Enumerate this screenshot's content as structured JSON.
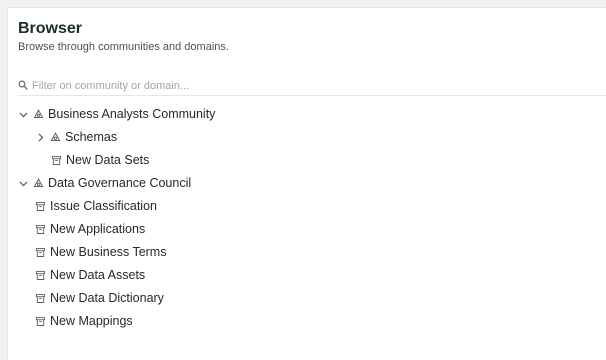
{
  "header": {
    "title": "Browser",
    "subtitle": "Browse through communities and domains."
  },
  "filter": {
    "placeholder": "Filter on community or domain..."
  },
  "tree": {
    "business_analysts": {
      "label": "Business Analysts Community",
      "expanded": true,
      "children": {
        "schemas": {
          "label": "Schemas",
          "expanded": false
        },
        "new_data_sets": {
          "label": "New Data Sets"
        }
      }
    },
    "data_governance": {
      "label": "Data Governance Council",
      "expanded": true,
      "children": {
        "issue_classification": {
          "label": "Issue Classification"
        },
        "new_applications": {
          "label": "New Applications"
        },
        "new_business_terms": {
          "label": "New Business Terms"
        },
        "new_data_assets": {
          "label": "New Data Assets"
        },
        "new_data_dictionary": {
          "label": "New Data Dictionary"
        },
        "new_mappings": {
          "label": "New Mappings"
        }
      }
    }
  },
  "colors": {
    "text": "#222a2a",
    "icon": "#5a6262",
    "placeholder": "#9ea6a6",
    "divider": "#e4e7e7"
  }
}
